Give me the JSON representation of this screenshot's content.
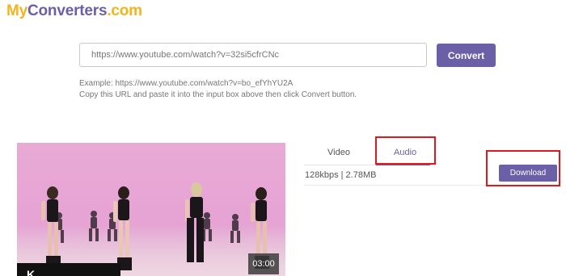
{
  "logo": {
    "part1": "My",
    "part2": "Converters",
    "part3": ".com"
  },
  "search": {
    "value": "https://www.youtube.com/watch?v=32si5cfrCNc",
    "convert_label": "Convert"
  },
  "help": {
    "example": "Example: https://www.youtube.com/watch?v=bo_efYhYU2A",
    "instruction": "Copy this URL and paste it into the input box above then click Convert button."
  },
  "video": {
    "duration": "03:00",
    "channel_logo_text": "K"
  },
  "tabs": [
    {
      "label": "Video",
      "active": false
    },
    {
      "label": "Audio",
      "active": true
    }
  ],
  "result": {
    "info": "128kbps | 2.78MB",
    "download_label": "Download"
  },
  "colors": {
    "accent": "#6b5fa8",
    "logo_yellow": "#f2b51c",
    "highlight_red": "#e0191e"
  }
}
